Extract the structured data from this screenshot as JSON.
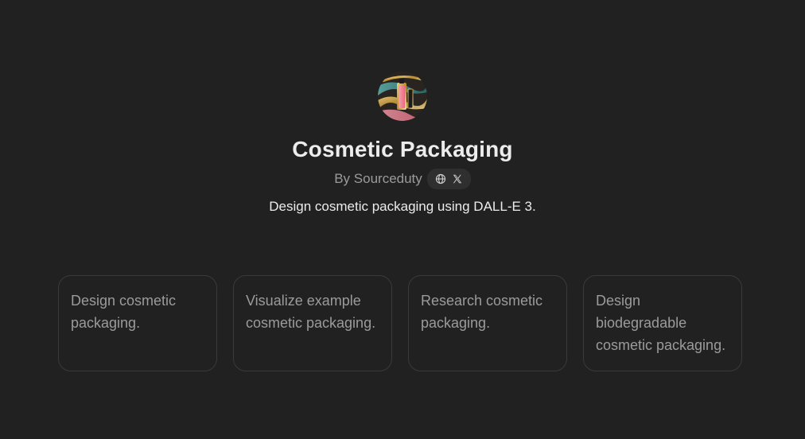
{
  "gpt": {
    "name": "Cosmetic Packaging",
    "author": "By Sourceduty",
    "description": "Design cosmetic packaging using DALL-E 3.",
    "social_icons": [
      "globe-icon",
      "x-logo-icon"
    ]
  },
  "conversation_starters": [
    {
      "label": "Design cosmetic packaging."
    },
    {
      "label": "Visualize example cosmetic packaging."
    },
    {
      "label": "Research cosmetic packaging."
    },
    {
      "label": "Design biodegradable cosmetic packaging."
    }
  ],
  "colors": {
    "background": "#212121",
    "text_primary": "#ececec",
    "text_secondary": "#9b9b9b",
    "card_border": "#3a3a3a",
    "pill_background": "#2f2f2f"
  }
}
